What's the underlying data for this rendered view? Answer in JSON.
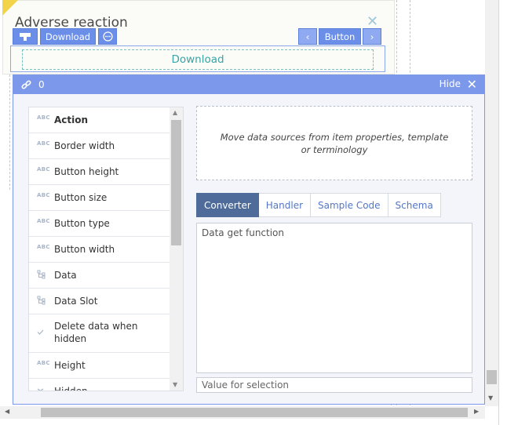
{
  "card": {
    "title": "Adverse reaction",
    "close_glyph": "✕",
    "toolbar": {
      "download_label": "Download",
      "button_label": "Button",
      "prev_glyph": "‹",
      "next_glyph": "›",
      "more_glyph": "⋯"
    },
    "download_text": "Download"
  },
  "panel": {
    "count": "0",
    "hide_label": "Hide",
    "close_glyph": "✕",
    "properties": [
      {
        "icon": "text-icon",
        "icon_text": "ABC",
        "label": "Action",
        "bold": true
      },
      {
        "icon": "text-icon",
        "icon_text": "ABC",
        "label": "Border width"
      },
      {
        "icon": "text-icon",
        "icon_text": "ABC",
        "label": "Button height"
      },
      {
        "icon": "text-icon",
        "icon_text": "ABC",
        "label": "Button size"
      },
      {
        "icon": "text-icon",
        "icon_text": "ABC",
        "label": "Button type"
      },
      {
        "icon": "text-icon",
        "icon_text": "ABC",
        "label": "Button width"
      },
      {
        "icon": "tree-icon",
        "label": "Data"
      },
      {
        "icon": "tree-icon",
        "label": "Data Slot"
      },
      {
        "icon": "check-icon",
        "label": "Delete data when hidden"
      },
      {
        "icon": "text-icon",
        "icon_text": "ABC",
        "label": "Height"
      },
      {
        "icon": "check-icon",
        "label": "Hidden"
      }
    ],
    "drop_hint": "Move data sources from item properties, template or terminology",
    "tabs": [
      {
        "label": "Converter",
        "active": true
      },
      {
        "label": "Handler"
      },
      {
        "label": "Sample Code"
      },
      {
        "label": "Schema"
      }
    ],
    "code_text": "Data get function",
    "value_placeholder": "Value for selection"
  },
  "colors": {
    "panel_header": "#7c98ea",
    "active_tab": "#4f6b9a",
    "accent_text": "#3aa3a3",
    "title_triangle": "#f2d34a"
  }
}
